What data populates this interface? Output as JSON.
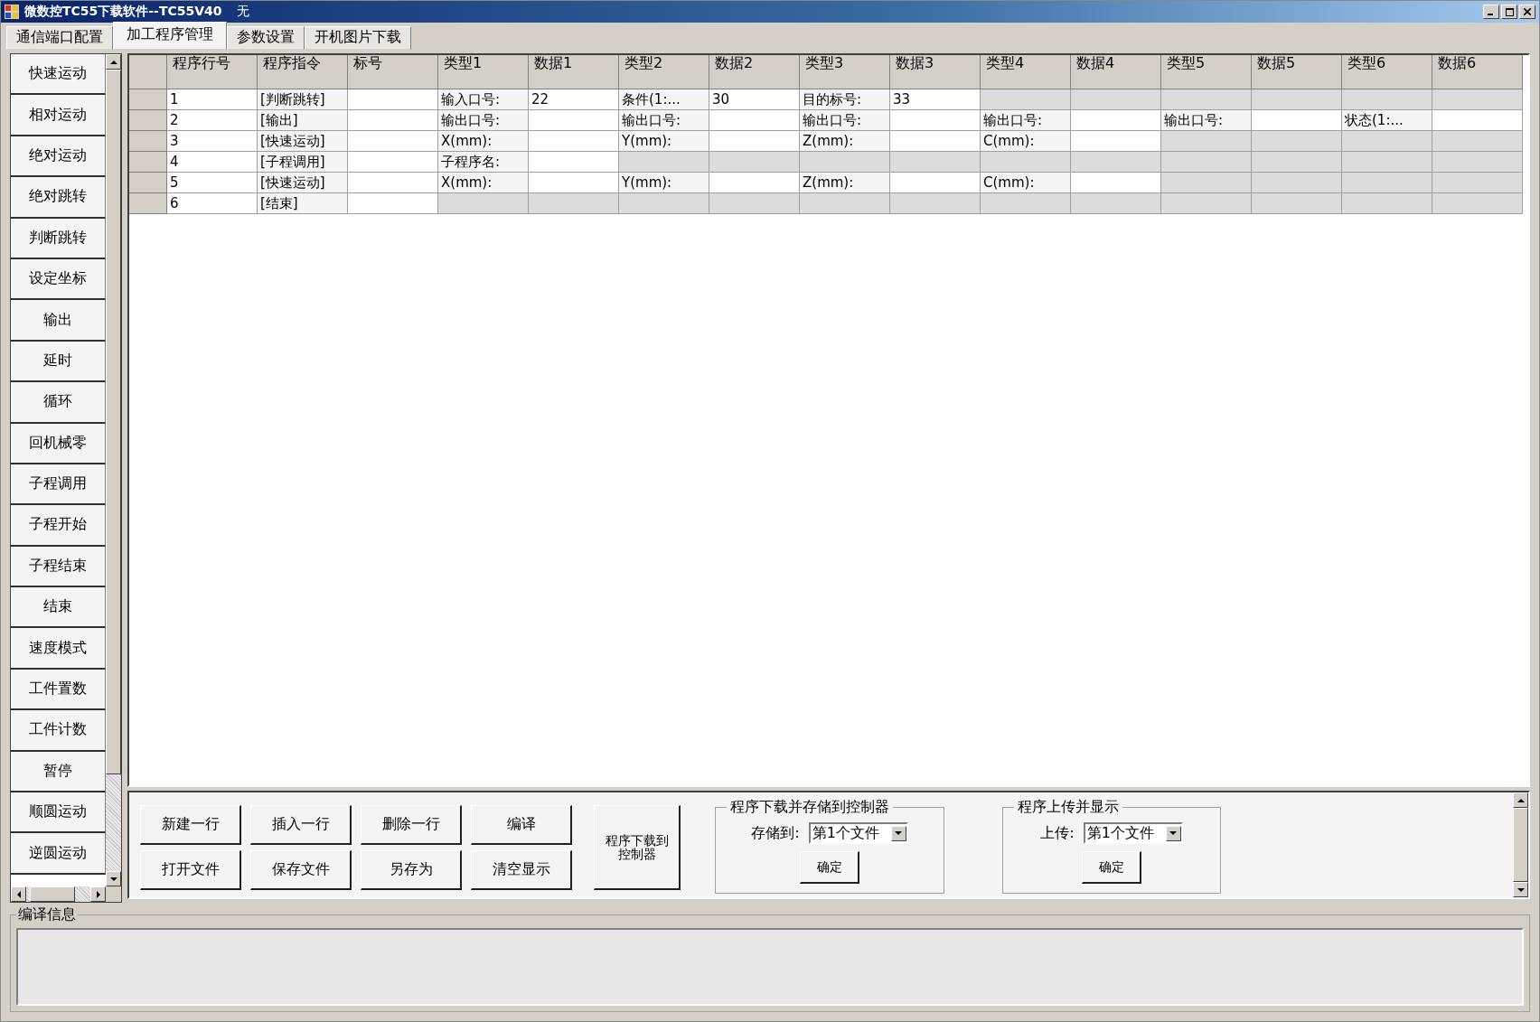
{
  "window": {
    "title": "微数控TC55下载软件--TC55V40",
    "status": "无"
  },
  "tabs": [
    {
      "label": "通信端口配置",
      "selected": false
    },
    {
      "label": "加工程序管理",
      "selected": true
    },
    {
      "label": "参数设置",
      "selected": false
    },
    {
      "label": "开机图片下载",
      "selected": false
    }
  ],
  "sidebar": {
    "items": [
      "快速运动",
      "相对运动",
      "绝对运动",
      "绝对跳转",
      "判断跳转",
      "设定坐标",
      "输出",
      "延时",
      "循环",
      "回机械零",
      "子程调用",
      "子程开始",
      "子程结束",
      "结束",
      "速度模式",
      "工件置数",
      "工件计数",
      "暂停",
      "顺圆运动",
      "逆圆运动"
    ]
  },
  "table": {
    "columns": [
      "程序行号",
      "程序指令",
      "标号",
      "类型1",
      "数据1",
      "类型2",
      "数据2",
      "类型3",
      "数据3",
      "类型4",
      "数据4",
      "类型5",
      "数据5",
      "类型6",
      "数据6"
    ],
    "rows": [
      {
        "cells": [
          {
            "kind": "value",
            "text": "1"
          },
          {
            "kind": "label",
            "text": "[判断跳转]"
          },
          {
            "kind": "value"
          },
          {
            "kind": "label",
            "text": "输入口号:"
          },
          {
            "kind": "value",
            "text": "22"
          },
          {
            "kind": "label",
            "text": "条件(1:..."
          },
          {
            "kind": "value",
            "text": "30"
          },
          {
            "kind": "label",
            "text": "目的标号:"
          },
          {
            "kind": "value",
            "text": "33"
          },
          {
            "kind": "disabled"
          },
          {
            "kind": "disabled"
          },
          {
            "kind": "disabled"
          },
          {
            "kind": "disabled"
          },
          {
            "kind": "disabled"
          },
          {
            "kind": "disabled"
          }
        ]
      },
      {
        "cells": [
          {
            "kind": "value",
            "text": "2"
          },
          {
            "kind": "label",
            "text": "[输出]"
          },
          {
            "kind": "value"
          },
          {
            "kind": "label",
            "text": "输出口号:"
          },
          {
            "kind": "value"
          },
          {
            "kind": "label",
            "text": "输出口号:"
          },
          {
            "kind": "value"
          },
          {
            "kind": "label",
            "text": "输出口号:"
          },
          {
            "kind": "value"
          },
          {
            "kind": "label",
            "text": "输出口号:"
          },
          {
            "kind": "value"
          },
          {
            "kind": "label",
            "text": "输出口号:"
          },
          {
            "kind": "value"
          },
          {
            "kind": "label",
            "text": "状态(1:..."
          },
          {
            "kind": "value"
          }
        ]
      },
      {
        "cells": [
          {
            "kind": "value",
            "text": "3"
          },
          {
            "kind": "label",
            "text": "[快速运动]"
          },
          {
            "kind": "value"
          },
          {
            "kind": "label",
            "text": "X(mm):"
          },
          {
            "kind": "value"
          },
          {
            "kind": "label",
            "text": "Y(mm):"
          },
          {
            "kind": "value"
          },
          {
            "kind": "label",
            "text": "Z(mm):"
          },
          {
            "kind": "value"
          },
          {
            "kind": "label",
            "text": "C(mm):"
          },
          {
            "kind": "value"
          },
          {
            "kind": "disabled"
          },
          {
            "kind": "disabled"
          },
          {
            "kind": "disabled"
          },
          {
            "kind": "disabled"
          }
        ]
      },
      {
        "cells": [
          {
            "kind": "value",
            "text": "4"
          },
          {
            "kind": "label",
            "text": "[子程调用]"
          },
          {
            "kind": "value"
          },
          {
            "kind": "label",
            "text": "子程序名:"
          },
          {
            "kind": "value"
          },
          {
            "kind": "disabled"
          },
          {
            "kind": "disabled"
          },
          {
            "kind": "disabled"
          },
          {
            "kind": "disabled"
          },
          {
            "kind": "disabled"
          },
          {
            "kind": "disabled"
          },
          {
            "kind": "disabled"
          },
          {
            "kind": "disabled"
          },
          {
            "kind": "disabled"
          },
          {
            "kind": "disabled"
          }
        ]
      },
      {
        "cells": [
          {
            "kind": "value",
            "text": "5"
          },
          {
            "kind": "label",
            "text": "[快速运动]"
          },
          {
            "kind": "value"
          },
          {
            "kind": "label",
            "text": "X(mm):"
          },
          {
            "kind": "value"
          },
          {
            "kind": "label",
            "text": "Y(mm):"
          },
          {
            "kind": "value"
          },
          {
            "kind": "label",
            "text": "Z(mm):"
          },
          {
            "kind": "value"
          },
          {
            "kind": "label",
            "text": "C(mm):"
          },
          {
            "kind": "value"
          },
          {
            "kind": "disabled"
          },
          {
            "kind": "disabled"
          },
          {
            "kind": "disabled"
          },
          {
            "kind": "disabled"
          }
        ]
      },
      {
        "cells": [
          {
            "kind": "value",
            "text": "6"
          },
          {
            "kind": "label",
            "text": "[结束]"
          },
          {
            "kind": "value"
          },
          {
            "kind": "disabled"
          },
          {
            "kind": "disabled"
          },
          {
            "kind": "disabled"
          },
          {
            "kind": "disabled"
          },
          {
            "kind": "disabled"
          },
          {
            "kind": "disabled"
          },
          {
            "kind": "disabled"
          },
          {
            "kind": "disabled"
          },
          {
            "kind": "disabled"
          },
          {
            "kind": "disabled"
          },
          {
            "kind": "disabled"
          },
          {
            "kind": "disabled"
          }
        ]
      }
    ]
  },
  "actions": {
    "buttons": [
      "新建一行",
      "插入一行",
      "删除一行",
      "编译",
      "打开文件",
      "保存文件",
      "另存为",
      "清空显示"
    ],
    "download_button": "程序下载到控制器"
  },
  "download_group": {
    "title": "程序下载并存储到控制器",
    "label": "存储到:",
    "value": "第1个文件",
    "button": "确定"
  },
  "upload_group": {
    "title": "程序上传并显示",
    "label": "上传:",
    "value": "第1个文件",
    "button": "确定"
  },
  "compile_info": {
    "title": "编译信息"
  }
}
